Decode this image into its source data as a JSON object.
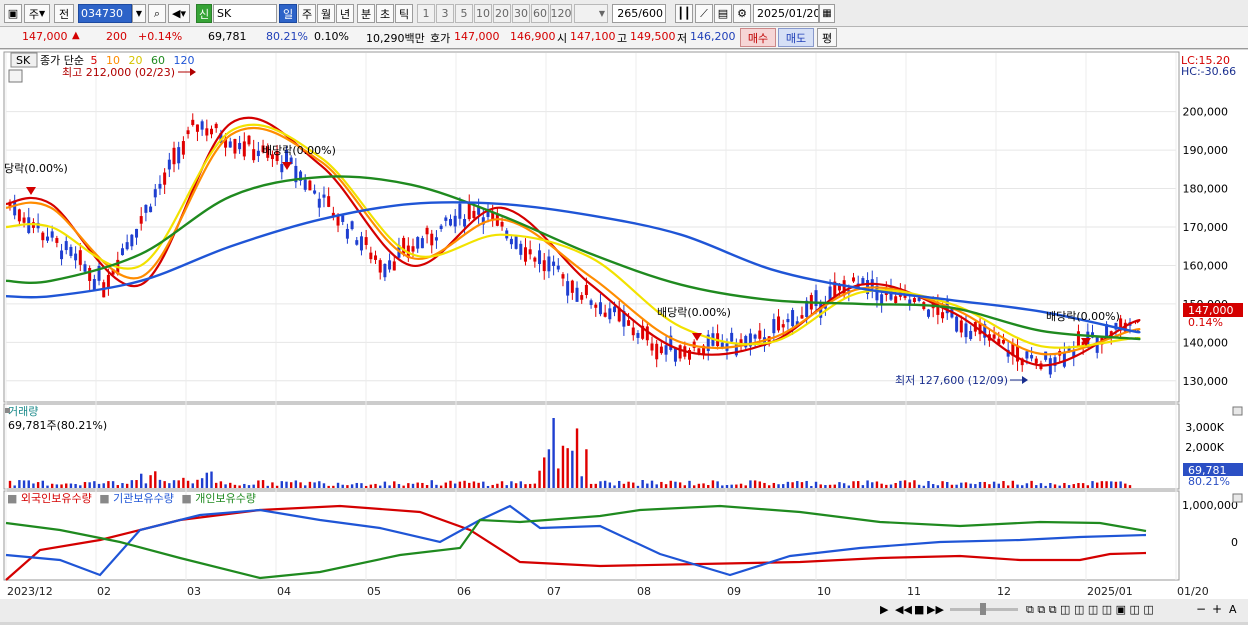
{
  "toolbar": {
    "period_select": "주",
    "prev_label": "전",
    "code": "034730",
    "name_badge": "신",
    "name": "SK",
    "period_tabs": [
      "일",
      "주",
      "월",
      "년",
      "분",
      "초",
      "틱"
    ],
    "interval_tabs": [
      "1",
      "3",
      "5",
      "10",
      "20",
      "30",
      "60",
      "120"
    ],
    "count": "265",
    "count_max": "/600",
    "date": "2025/01/20"
  },
  "quote": {
    "price": "147,000",
    "change": "200",
    "change_pct": "+0.14%",
    "volume": "69,781",
    "vol_ratio": "80.21%",
    "turnover": "0.10%",
    "value": "10,290백만",
    "bid_label": "호가",
    "bid1": "147,000",
    "bid2": "146,900",
    "open_label": "시",
    "open": "147,100",
    "high_label": "고",
    "high": "149,500",
    "low_label": "저",
    "low": "146,200",
    "buy_label": "매수",
    "sell_label": "매도",
    "eval_label": "평"
  },
  "main_pane": {
    "stock_tag": "SK",
    "legend_title": "종가 단순",
    "legend_periods": [
      {
        "label": "5",
        "color": "#d40000"
      },
      {
        "label": "10",
        "color": "#ff8c00"
      },
      {
        "label": "20",
        "color": "#f2e200"
      },
      {
        "label": "60",
        "color": "#1f8a1f"
      },
      {
        "label": "120",
        "color": "#1f55d6"
      }
    ],
    "high_note": "최고 212,000 (02/23)",
    "low_note": "최저 127,600 (12/09)",
    "lc": "LC:15.20",
    "hc": "HC:-30.66",
    "price_tag": "147,000",
    "pct_tag": "0.14%",
    "annotations": [
      "당락(0.00%)",
      "배당락(0.00%)",
      "배당락(0.00%)",
      "배당락(0.00%)"
    ],
    "yticks": [
      "200,000",
      "190,000",
      "180,000",
      "170,000",
      "160,000",
      "150,000",
      "140,000",
      "130,000"
    ]
  },
  "volume_pane": {
    "title": "거래량",
    "value_label": "69,781주(80.21%)",
    "yticks": [
      "3,000K",
      "2,000K",
      "1,000K"
    ],
    "tag_value": "69,781",
    "tag_pct": "80.21%"
  },
  "holding_pane": {
    "legend": [
      {
        "label": "외국인보유수량",
        "color": "#d40000"
      },
      {
        "label": "기관보유수량",
        "color": "#1f55d6"
      },
      {
        "label": "개인보유수량",
        "color": "#1f8a1f"
      }
    ],
    "yticks": [
      "1,000,000",
      "0"
    ]
  },
  "xaxis": {
    "labels": [
      "2023/12",
      "02",
      "03",
      "04",
      "05",
      "06",
      "07",
      "08",
      "09",
      "10",
      "11",
      "12",
      "2025/01",
      "01/20"
    ]
  },
  "chart_data": {
    "type": "line",
    "title": "SK",
    "ylim": [
      125000,
      215000
    ],
    "x": [
      "2023/12",
      "02",
      "03",
      "04",
      "05",
      "06",
      "07",
      "08",
      "09",
      "10",
      "11",
      "12",
      "2025/01"
    ],
    "series": [
      {
        "name": "5",
        "values": [
          176000,
          155000,
          197000,
          186000,
          160000,
          175000,
          155000,
          138000,
          140000,
          155000,
          148000,
          134000,
          145000
        ]
      },
      {
        "name": "10",
        "values": [
          175000,
          157000,
          194000,
          187000,
          162000,
          172000,
          157000,
          140000,
          141000,
          154000,
          149000,
          137000,
          143000
        ]
      },
      {
        "name": "20",
        "values": [
          170000,
          160000,
          195000,
          188000,
          163000,
          168000,
          162000,
          144000,
          140000,
          153000,
          150000,
          139000,
          141000
        ]
      },
      {
        "name": "60",
        "values": [
          156000,
          163000,
          178000,
          183000,
          181000,
          173000,
          163000,
          155000,
          151000,
          150000,
          149000,
          143000,
          141000
        ]
      },
      {
        "name": "120",
        "values": [
          152000,
          156000,
          165000,
          172000,
          176000,
          176000,
          173000,
          168000,
          159000,
          154000,
          151000,
          148000,
          143000
        ]
      }
    ],
    "annotations": [
      "최고 212,000 (02/23)",
      "최저 127,600 (12/09)"
    ]
  }
}
